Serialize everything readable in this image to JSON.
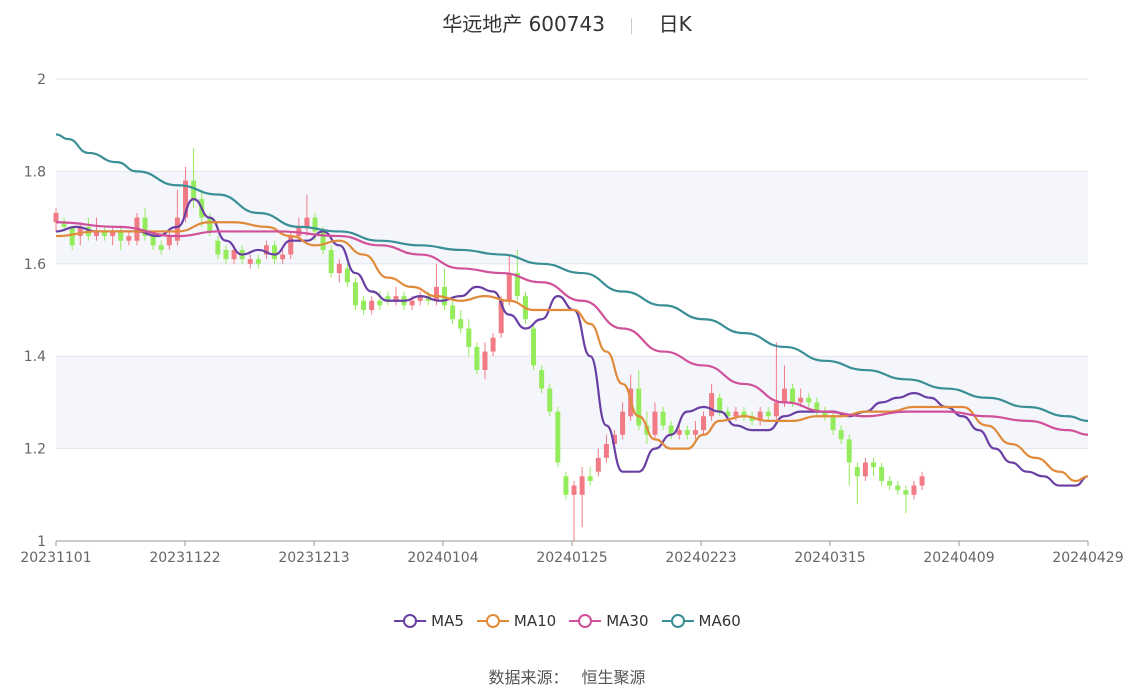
{
  "header": {
    "stock_name": "华远地产 600743",
    "period": "日K"
  },
  "source": {
    "label": "数据来源：",
    "name": "恒生聚源"
  },
  "colors": {
    "up": "#f07b85",
    "down": "#94ec5c",
    "grid": "#e3e6f0",
    "band": "#f4f6fb",
    "axis": "#999999"
  },
  "chart_data": {
    "type": "candlestick",
    "ylim": [
      1,
      2
    ],
    "yticks": [
      "1",
      "1.2",
      "1.4",
      "1.6",
      "1.8",
      "2"
    ],
    "xticks": [
      "20231101",
      "20231122",
      "20231213",
      "20240104",
      "20240125",
      "20240223",
      "20240315",
      "20240409",
      "20240429"
    ],
    "grid": true,
    "legend_position": "bottom-center",
    "series": [
      {
        "name": "MA5",
        "color": "#6a3fa3",
        "points": [
          [
            0,
            1.67
          ],
          [
            5,
            1.68
          ],
          [
            10,
            1.67
          ],
          [
            15,
            1.67
          ],
          [
            20,
            1.67
          ],
          [
            25,
            1.66
          ],
          [
            30,
            1.68
          ],
          [
            34,
            1.74
          ],
          [
            38,
            1.7
          ],
          [
            42,
            1.65
          ],
          [
            46,
            1.62
          ],
          [
            50,
            1.63
          ],
          [
            54,
            1.62
          ],
          [
            58,
            1.65
          ],
          [
            62,
            1.65
          ],
          [
            66,
            1.67
          ],
          [
            70,
            1.64
          ],
          [
            74,
            1.58
          ],
          [
            78,
            1.54
          ],
          [
            82,
            1.52
          ],
          [
            86,
            1.52
          ],
          [
            90,
            1.53
          ],
          [
            95,
            1.52
          ],
          [
            100,
            1.53
          ],
          [
            104,
            1.55
          ],
          [
            108,
            1.54
          ],
          [
            112,
            1.49
          ],
          [
            116,
            1.46
          ],
          [
            120,
            1.48
          ],
          [
            124,
            1.53
          ],
          [
            128,
            1.5
          ],
          [
            132,
            1.4
          ],
          [
            136,
            1.25
          ],
          [
            140,
            1.15
          ],
          [
            144,
            1.15
          ],
          [
            148,
            1.2
          ],
          [
            152,
            1.23
          ],
          [
            156,
            1.28
          ],
          [
            160,
            1.29
          ],
          [
            164,
            1.28
          ],
          [
            168,
            1.25
          ],
          [
            172,
            1.24
          ],
          [
            176,
            1.24
          ],
          [
            180,
            1.27
          ],
          [
            184,
            1.28
          ],
          [
            188,
            1.28
          ],
          [
            192,
            1.28
          ],
          [
            196,
            1.27
          ],
          [
            200,
            1.28
          ],
          [
            204,
            1.3
          ],
          [
            208,
            1.31
          ],
          [
            212,
            1.32
          ],
          [
            216,
            1.31
          ],
          [
            220,
            1.29
          ],
          [
            224,
            1.27
          ],
          [
            228,
            1.24
          ],
          [
            232,
            1.2
          ],
          [
            236,
            1.17
          ],
          [
            240,
            1.15
          ],
          [
            244,
            1.14
          ],
          [
            248,
            1.12
          ],
          [
            252,
            1.12
          ],
          [
            255,
            1.14
          ]
        ]
      },
      {
        "name": "MA10",
        "color": "#e08a3a",
        "points": [
          [
            0,
            1.66
          ],
          [
            10,
            1.67
          ],
          [
            20,
            1.67
          ],
          [
            30,
            1.67
          ],
          [
            38,
            1.69
          ],
          [
            44,
            1.69
          ],
          [
            52,
            1.68
          ],
          [
            58,
            1.66
          ],
          [
            64,
            1.64
          ],
          [
            70,
            1.65
          ],
          [
            76,
            1.62
          ],
          [
            82,
            1.57
          ],
          [
            88,
            1.55
          ],
          [
            94,
            1.53
          ],
          [
            100,
            1.52
          ],
          [
            106,
            1.53
          ],
          [
            112,
            1.52
          ],
          [
            118,
            1.5
          ],
          [
            124,
            1.5
          ],
          [
            128,
            1.5
          ],
          [
            132,
            1.47
          ],
          [
            136,
            1.41
          ],
          [
            140,
            1.34
          ],
          [
            144,
            1.27
          ],
          [
            148,
            1.22
          ],
          [
            152,
            1.2
          ],
          [
            156,
            1.2
          ],
          [
            160,
            1.23
          ],
          [
            164,
            1.26
          ],
          [
            170,
            1.27
          ],
          [
            176,
            1.26
          ],
          [
            182,
            1.26
          ],
          [
            188,
            1.27
          ],
          [
            194,
            1.27
          ],
          [
            200,
            1.28
          ],
          [
            206,
            1.28
          ],
          [
            212,
            1.29
          ],
          [
            218,
            1.29
          ],
          [
            224,
            1.29
          ],
          [
            230,
            1.25
          ],
          [
            236,
            1.21
          ],
          [
            242,
            1.18
          ],
          [
            248,
            1.15
          ],
          [
            252,
            1.13
          ],
          [
            255,
            1.14
          ]
        ]
      },
      {
        "name": "MA30",
        "color": "#d0509a",
        "points": [
          [
            0,
            1.69
          ],
          [
            15,
            1.68
          ],
          [
            30,
            1.66
          ],
          [
            40,
            1.67
          ],
          [
            55,
            1.67
          ],
          [
            70,
            1.66
          ],
          [
            80,
            1.64
          ],
          [
            90,
            1.62
          ],
          [
            100,
            1.59
          ],
          [
            110,
            1.58
          ],
          [
            120,
            1.56
          ],
          [
            130,
            1.52
          ],
          [
            140,
            1.46
          ],
          [
            150,
            1.41
          ],
          [
            160,
            1.38
          ],
          [
            170,
            1.34
          ],
          [
            180,
            1.3
          ],
          [
            190,
            1.28
          ],
          [
            200,
            1.27
          ],
          [
            210,
            1.28
          ],
          [
            220,
            1.28
          ],
          [
            230,
            1.27
          ],
          [
            240,
            1.26
          ],
          [
            250,
            1.24
          ],
          [
            255,
            1.23
          ]
        ]
      },
      {
        "name": "MA60",
        "color": "#3a8f96",
        "points": [
          [
            0,
            1.88
          ],
          [
            3,
            1.87
          ],
          [
            8,
            1.84
          ],
          [
            15,
            1.82
          ],
          [
            20,
            1.8
          ],
          [
            30,
            1.77
          ],
          [
            40,
            1.75
          ],
          [
            50,
            1.71
          ],
          [
            60,
            1.68
          ],
          [
            70,
            1.67
          ],
          [
            80,
            1.65
          ],
          [
            90,
            1.64
          ],
          [
            100,
            1.63
          ],
          [
            110,
            1.62
          ],
          [
            120,
            1.6
          ],
          [
            130,
            1.58
          ],
          [
            140,
            1.54
          ],
          [
            150,
            1.51
          ],
          [
            160,
            1.48
          ],
          [
            170,
            1.45
          ],
          [
            180,
            1.42
          ],
          [
            190,
            1.39
          ],
          [
            200,
            1.37
          ],
          [
            210,
            1.35
          ],
          [
            220,
            1.33
          ],
          [
            230,
            1.31
          ],
          [
            240,
            1.29
          ],
          [
            250,
            1.27
          ],
          [
            255,
            1.26
          ]
        ]
      }
    ],
    "candles": [
      [
        0,
        1.69,
        1.71,
        1.72,
        1.67
      ],
      [
        2,
        1.69,
        1.68,
        1.7,
        1.67
      ],
      [
        4,
        1.68,
        1.64,
        1.68,
        1.63
      ],
      [
        6,
        1.66,
        1.68,
        1.69,
        1.64
      ],
      [
        8,
        1.68,
        1.66,
        1.7,
        1.65
      ],
      [
        10,
        1.66,
        1.67,
        1.7,
        1.65
      ],
      [
        12,
        1.67,
        1.66,
        1.68,
        1.65
      ],
      [
        14,
        1.66,
        1.67,
        1.68,
        1.64
      ],
      [
        16,
        1.67,
        1.65,
        1.68,
        1.63
      ],
      [
        18,
        1.65,
        1.66,
        1.67,
        1.64
      ],
      [
        20,
        1.65,
        1.7,
        1.71,
        1.64
      ],
      [
        22,
        1.7,
        1.66,
        1.72,
        1.65
      ],
      [
        24,
        1.66,
        1.64,
        1.67,
        1.63
      ],
      [
        26,
        1.64,
        1.63,
        1.65,
        1.62
      ],
      [
        28,
        1.64,
        1.66,
        1.67,
        1.63
      ],
      [
        30,
        1.65,
        1.7,
        1.76,
        1.64
      ],
      [
        32,
        1.7,
        1.78,
        1.81,
        1.69
      ],
      [
        34,
        1.78,
        1.74,
        1.85,
        1.72
      ],
      [
        36,
        1.74,
        1.7,
        1.76,
        1.68
      ],
      [
        38,
        1.7,
        1.67,
        1.71,
        1.66
      ],
      [
        40,
        1.65,
        1.62,
        1.66,
        1.61
      ],
      [
        42,
        1.63,
        1.61,
        1.64,
        1.6
      ],
      [
        44,
        1.61,
        1.63,
        1.64,
        1.6
      ],
      [
        46,
        1.63,
        1.61,
        1.64,
        1.6
      ],
      [
        48,
        1.6,
        1.61,
        1.62,
        1.59
      ],
      [
        50,
        1.61,
        1.6,
        1.62,
        1.59
      ],
      [
        52,
        1.62,
        1.64,
        1.65,
        1.61
      ],
      [
        54,
        1.64,
        1.61,
        1.65,
        1.6
      ],
      [
        56,
        1.61,
        1.62,
        1.63,
        1.6
      ],
      [
        58,
        1.62,
        1.66,
        1.67,
        1.61
      ],
      [
        60,
        1.66,
        1.68,
        1.7,
        1.65
      ],
      [
        62,
        1.68,
        1.7,
        1.75,
        1.66
      ],
      [
        64,
        1.7,
        1.67,
        1.71,
        1.65
      ],
      [
        66,
        1.67,
        1.63,
        1.68,
        1.62
      ],
      [
        68,
        1.63,
        1.58,
        1.64,
        1.57
      ],
      [
        70,
        1.58,
        1.6,
        1.61,
        1.56
      ],
      [
        72,
        1.59,
        1.56,
        1.6,
        1.55
      ],
      [
        74,
        1.56,
        1.51,
        1.57,
        1.5
      ],
      [
        76,
        1.52,
        1.5,
        1.53,
        1.49
      ],
      [
        78,
        1.5,
        1.52,
        1.53,
        1.49
      ],
      [
        80,
        1.52,
        1.51,
        1.54,
        1.5
      ],
      [
        82,
        1.53,
        1.52,
        1.54,
        1.51
      ],
      [
        84,
        1.52,
        1.53,
        1.55,
        1.51
      ],
      [
        86,
        1.53,
        1.51,
        1.54,
        1.5
      ],
      [
        88,
        1.51,
        1.52,
        1.53,
        1.5
      ],
      [
        90,
        1.52,
        1.53,
        1.54,
        1.51
      ],
      [
        92,
        1.53,
        1.52,
        1.54,
        1.51
      ],
      [
        94,
        1.52,
        1.55,
        1.6,
        1.51
      ],
      [
        96,
        1.55,
        1.51,
        1.59,
        1.5
      ],
      [
        98,
        1.51,
        1.48,
        1.52,
        1.47
      ],
      [
        100,
        1.48,
        1.46,
        1.5,
        1.45
      ],
      [
        102,
        1.46,
        1.42,
        1.48,
        1.4
      ],
      [
        104,
        1.42,
        1.37,
        1.43,
        1.36
      ],
      [
        106,
        1.37,
        1.41,
        1.43,
        1.35
      ],
      [
        108,
        1.41,
        1.44,
        1.45,
        1.4
      ],
      [
        110,
        1.45,
        1.52,
        1.53,
        1.44
      ],
      [
        112,
        1.52,
        1.58,
        1.62,
        1.51
      ],
      [
        114,
        1.58,
        1.53,
        1.63,
        1.52
      ],
      [
        116,
        1.53,
        1.48,
        1.54,
        1.47
      ],
      [
        118,
        1.46,
        1.38,
        1.47,
        1.37
      ],
      [
        120,
        1.37,
        1.33,
        1.38,
        1.32
      ],
      [
        122,
        1.33,
        1.28,
        1.34,
        1.27
      ],
      [
        124,
        1.28,
        1.17,
        1.29,
        1.16
      ],
      [
        126,
        1.14,
        1.1,
        1.15,
        1.09
      ],
      [
        128,
        1.1,
        1.12,
        1.13,
        1.0
      ],
      [
        130,
        1.1,
        1.14,
        1.16,
        1.03
      ],
      [
        132,
        1.14,
        1.13,
        1.16,
        1.12
      ],
      [
        134,
        1.15,
        1.18,
        1.2,
        1.14
      ],
      [
        136,
        1.18,
        1.21,
        1.23,
        1.17
      ],
      [
        138,
        1.21,
        1.23,
        1.24,
        1.2
      ],
      [
        140,
        1.23,
        1.28,
        1.3,
        1.22
      ],
      [
        142,
        1.27,
        1.33,
        1.36,
        1.26
      ],
      [
        144,
        1.33,
        1.25,
        1.37,
        1.24
      ],
      [
        146,
        1.25,
        1.23,
        1.28,
        1.21
      ],
      [
        148,
        1.23,
        1.28,
        1.3,
        1.22
      ],
      [
        150,
        1.28,
        1.25,
        1.29,
        1.24
      ],
      [
        152,
        1.25,
        1.23,
        1.26,
        1.22
      ],
      [
        154,
        1.23,
        1.24,
        1.25,
        1.22
      ],
      [
        156,
        1.24,
        1.23,
        1.25,
        1.22
      ],
      [
        158,
        1.23,
        1.24,
        1.26,
        1.22
      ],
      [
        160,
        1.24,
        1.27,
        1.28,
        1.23
      ],
      [
        162,
        1.27,
        1.32,
        1.34,
        1.26
      ],
      [
        164,
        1.31,
        1.28,
        1.32,
        1.27
      ],
      [
        166,
        1.28,
        1.27,
        1.29,
        1.26
      ],
      [
        168,
        1.27,
        1.28,
        1.29,
        1.26
      ],
      [
        170,
        1.28,
        1.27,
        1.29,
        1.26
      ],
      [
        172,
        1.27,
        1.26,
        1.28,
        1.25
      ],
      [
        174,
        1.26,
        1.28,
        1.29,
        1.25
      ],
      [
        176,
        1.28,
        1.27,
        1.29,
        1.26
      ],
      [
        178,
        1.27,
        1.3,
        1.43,
        1.26
      ],
      [
        180,
        1.3,
        1.33,
        1.38,
        1.29
      ],
      [
        182,
        1.33,
        1.3,
        1.34,
        1.29
      ],
      [
        184,
        1.3,
        1.31,
        1.33,
        1.29
      ],
      [
        186,
        1.31,
        1.3,
        1.32,
        1.29
      ],
      [
        188,
        1.3,
        1.28,
        1.31,
        1.27
      ],
      [
        190,
        1.28,
        1.27,
        1.29,
        1.26
      ],
      [
        192,
        1.27,
        1.24,
        1.28,
        1.23
      ],
      [
        194,
        1.24,
        1.22,
        1.25,
        1.21
      ],
      [
        196,
        1.22,
        1.17,
        1.23,
        1.12
      ],
      [
        198,
        1.16,
        1.14,
        1.17,
        1.08
      ],
      [
        200,
        1.14,
        1.17,
        1.18,
        1.13
      ],
      [
        202,
        1.17,
        1.16,
        1.18,
        1.14
      ],
      [
        204,
        1.16,
        1.13,
        1.17,
        1.12
      ],
      [
        206,
        1.13,
        1.12,
        1.14,
        1.11
      ],
      [
        208,
        1.12,
        1.11,
        1.13,
        1.1
      ],
      [
        210,
        1.11,
        1.1,
        1.12,
        1.06
      ],
      [
        212,
        1.1,
        1.12,
        1.13,
        1.09
      ],
      [
        214,
        1.12,
        1.14,
        1.15,
        1.11
      ]
    ]
  }
}
